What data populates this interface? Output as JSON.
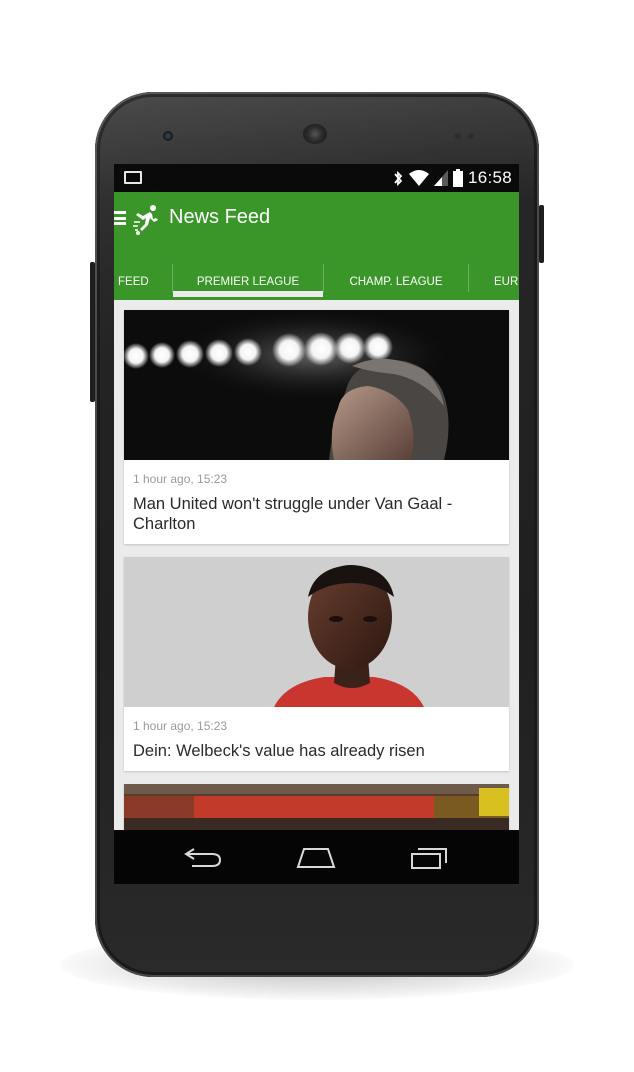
{
  "status_bar": {
    "time": "16:58",
    "icons": [
      "cast-icon",
      "bluetooth-icon",
      "wifi-icon",
      "signal-icon",
      "battery-icon"
    ]
  },
  "app_bar": {
    "title": "News Feed",
    "color": "#3a9628"
  },
  "tabs": [
    {
      "label": "FEED",
      "selected": false
    },
    {
      "label": "PREMIER LEAGUE",
      "selected": true
    },
    {
      "label": "CHAMP. LEAGUE",
      "selected": false
    },
    {
      "label": "EUR",
      "selected": false
    }
  ],
  "articles": [
    {
      "timestamp": "1 hour ago, 15:23",
      "headline": "Man United won't struggle under Van Gaal - Charlton",
      "image": "stadium-floodlights-manager-photo"
    },
    {
      "timestamp": "1 hour ago, 15:23",
      "headline": "Dein: Welbeck's value has already risen",
      "image": "player-portrait-photo"
    },
    {
      "timestamp": "",
      "headline": "",
      "image": "stadium-crowd-photo"
    }
  ],
  "nav_bar": {
    "icons": [
      "back-icon",
      "home-icon",
      "recents-icon"
    ]
  }
}
